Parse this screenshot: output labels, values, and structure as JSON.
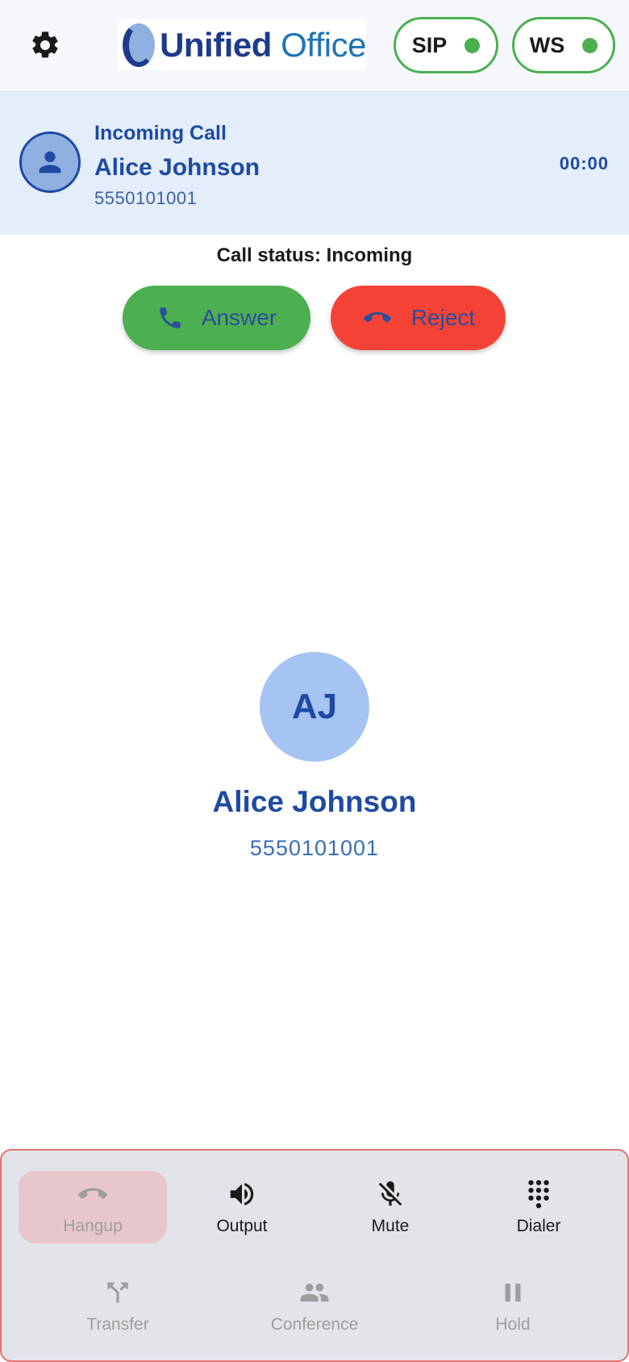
{
  "header": {
    "logo_word1": "Unified",
    "logo_word2": "Office",
    "sip_label": "SIP",
    "ws_label": "WS",
    "status_color": "#4caf50"
  },
  "incoming": {
    "label": "Incoming Call",
    "name": "Alice Johnson",
    "number": "5550101001",
    "timer": "00:00"
  },
  "call": {
    "status": "Call status: Incoming",
    "answer_label": "Answer",
    "reject_label": "Reject",
    "answer_color": "#4caf50",
    "reject_color": "#f44336"
  },
  "caller": {
    "initials": "AJ",
    "name": "Alice Johnson",
    "number": "5550101001"
  },
  "controls": {
    "hangup": "Hangup",
    "output": "Output",
    "mute": "Mute",
    "dialer": "Dialer",
    "transfer": "Transfer",
    "conference": "Conference",
    "hold": "Hold"
  },
  "icons": [
    "gear-icon",
    "person-icon",
    "phone-icon",
    "phone-hangup-icon",
    "speaker-icon",
    "mic-off-icon",
    "dialpad-icon",
    "transfer-icon",
    "group-icon",
    "pause-icon"
  ]
}
